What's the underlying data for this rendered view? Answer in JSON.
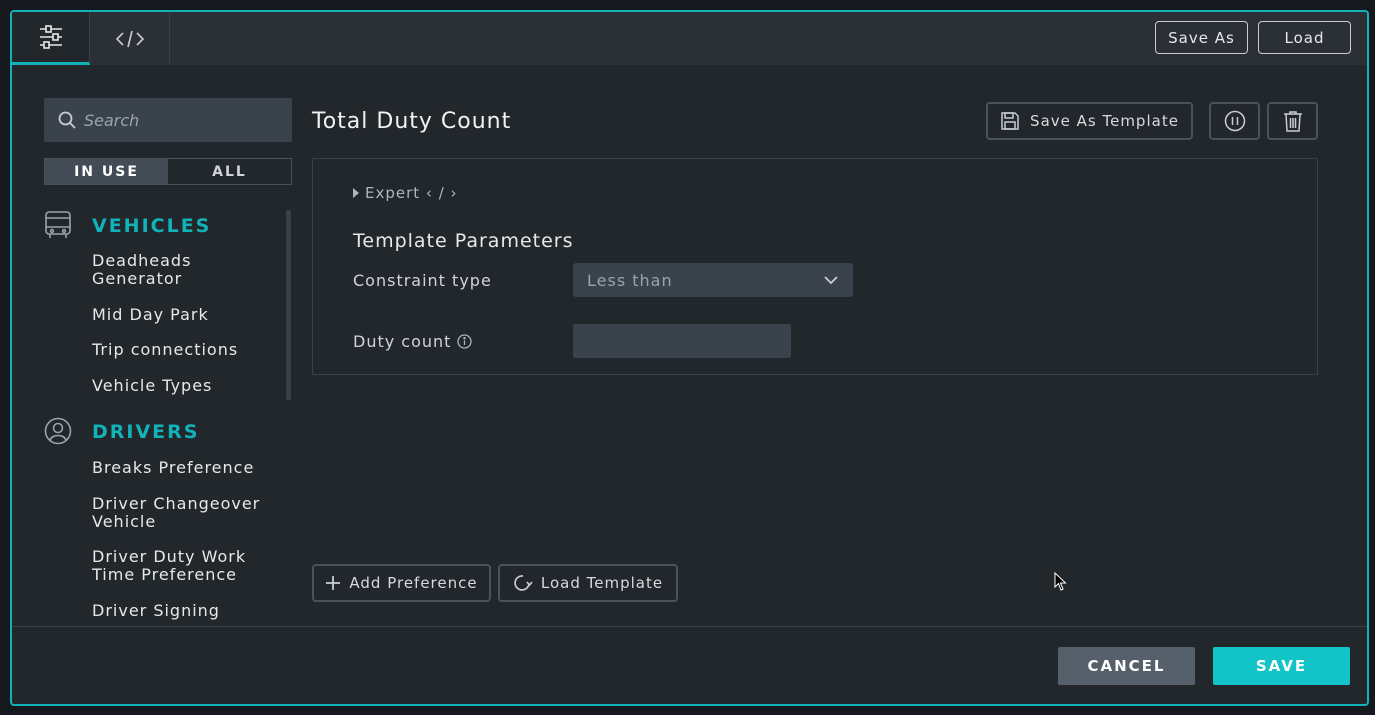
{
  "topbar": {
    "tabs": [
      {
        "icon": "sliders-icon",
        "active": true
      },
      {
        "icon": "code-icon",
        "active": false
      }
    ],
    "save_as_label": "Save As",
    "load_label": "Load"
  },
  "sidebar": {
    "search_placeholder": "Search",
    "filter": {
      "in_use": "IN USE",
      "all": "ALL",
      "selected": "IN USE"
    },
    "sections": [
      {
        "title": "VEHICLES",
        "icon": "bus-icon",
        "items": [
          "Deadheads Generator",
          "Mid Day Park",
          "Trip connections",
          "Vehicle Types"
        ]
      },
      {
        "title": "DRIVERS",
        "icon": "user-icon",
        "items": [
          "Breaks Preference",
          "Driver Changeover Vehicle",
          "Driver Duty Work Time Preference",
          "Driver Signing"
        ]
      }
    ]
  },
  "main": {
    "title": "Total Duty Count",
    "save_template_label": "Save As Template",
    "expert_label": "Expert ‹ / ›",
    "params_title": "Template Parameters",
    "constraint_label": "Constraint type",
    "constraint_value": "Less than",
    "duty_count_label": "Duty count",
    "duty_count_value": "",
    "add_preference_label": "Add Preference",
    "load_template_label": "Load Template"
  },
  "footer": {
    "cancel_label": "CANCEL",
    "save_label": "SAVE"
  },
  "colors": {
    "accent": "#12b3b8",
    "save_button": "#12c3c8",
    "cancel_button": "#56606a"
  }
}
